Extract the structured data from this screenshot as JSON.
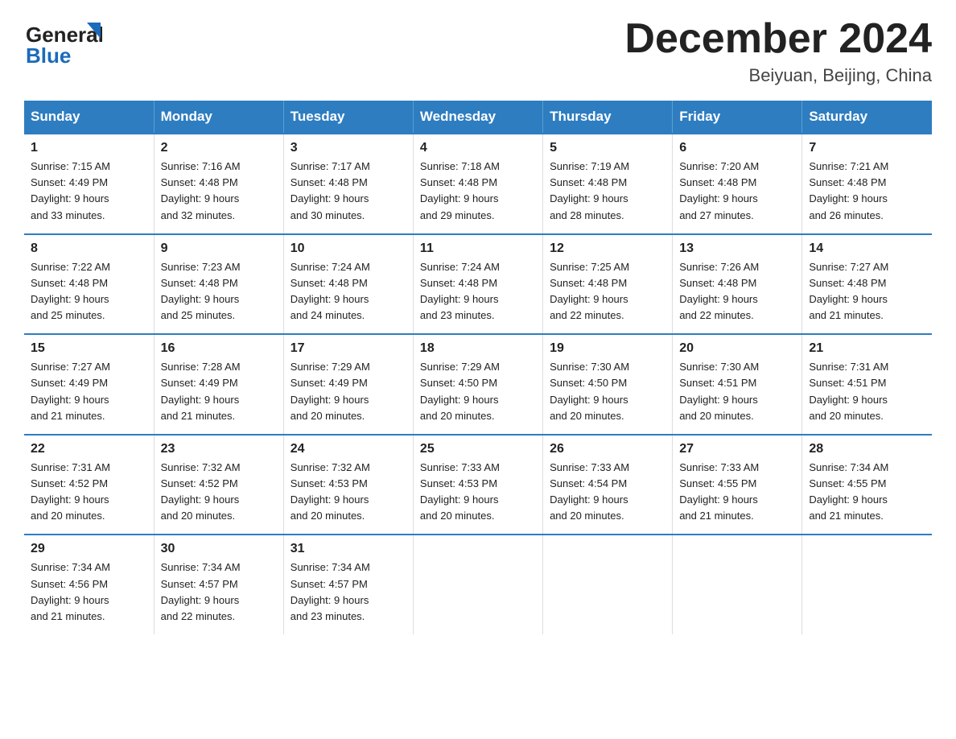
{
  "header": {
    "logo_general": "General",
    "logo_blue": "Blue",
    "month_title": "December 2024",
    "location": "Beiyuan, Beijing, China"
  },
  "days_of_week": [
    "Sunday",
    "Monday",
    "Tuesday",
    "Wednesday",
    "Thursday",
    "Friday",
    "Saturday"
  ],
  "weeks": [
    [
      {
        "day": "1",
        "sunrise": "7:15 AM",
        "sunset": "4:49 PM",
        "daylight": "9 hours and 33 minutes."
      },
      {
        "day": "2",
        "sunrise": "7:16 AM",
        "sunset": "4:48 PM",
        "daylight": "9 hours and 32 minutes."
      },
      {
        "day": "3",
        "sunrise": "7:17 AM",
        "sunset": "4:48 PM",
        "daylight": "9 hours and 30 minutes."
      },
      {
        "day": "4",
        "sunrise": "7:18 AM",
        "sunset": "4:48 PM",
        "daylight": "9 hours and 29 minutes."
      },
      {
        "day": "5",
        "sunrise": "7:19 AM",
        "sunset": "4:48 PM",
        "daylight": "9 hours and 28 minutes."
      },
      {
        "day": "6",
        "sunrise": "7:20 AM",
        "sunset": "4:48 PM",
        "daylight": "9 hours and 27 minutes."
      },
      {
        "day": "7",
        "sunrise": "7:21 AM",
        "sunset": "4:48 PM",
        "daylight": "9 hours and 26 minutes."
      }
    ],
    [
      {
        "day": "8",
        "sunrise": "7:22 AM",
        "sunset": "4:48 PM",
        "daylight": "9 hours and 25 minutes."
      },
      {
        "day": "9",
        "sunrise": "7:23 AM",
        "sunset": "4:48 PM",
        "daylight": "9 hours and 25 minutes."
      },
      {
        "day": "10",
        "sunrise": "7:24 AM",
        "sunset": "4:48 PM",
        "daylight": "9 hours and 24 minutes."
      },
      {
        "day": "11",
        "sunrise": "7:24 AM",
        "sunset": "4:48 PM",
        "daylight": "9 hours and 23 minutes."
      },
      {
        "day": "12",
        "sunrise": "7:25 AM",
        "sunset": "4:48 PM",
        "daylight": "9 hours and 22 minutes."
      },
      {
        "day": "13",
        "sunrise": "7:26 AM",
        "sunset": "4:48 PM",
        "daylight": "9 hours and 22 minutes."
      },
      {
        "day": "14",
        "sunrise": "7:27 AM",
        "sunset": "4:48 PM",
        "daylight": "9 hours and 21 minutes."
      }
    ],
    [
      {
        "day": "15",
        "sunrise": "7:27 AM",
        "sunset": "4:49 PM",
        "daylight": "9 hours and 21 minutes."
      },
      {
        "day": "16",
        "sunrise": "7:28 AM",
        "sunset": "4:49 PM",
        "daylight": "9 hours and 21 minutes."
      },
      {
        "day": "17",
        "sunrise": "7:29 AM",
        "sunset": "4:49 PM",
        "daylight": "9 hours and 20 minutes."
      },
      {
        "day": "18",
        "sunrise": "7:29 AM",
        "sunset": "4:50 PM",
        "daylight": "9 hours and 20 minutes."
      },
      {
        "day": "19",
        "sunrise": "7:30 AM",
        "sunset": "4:50 PM",
        "daylight": "9 hours and 20 minutes."
      },
      {
        "day": "20",
        "sunrise": "7:30 AM",
        "sunset": "4:51 PM",
        "daylight": "9 hours and 20 minutes."
      },
      {
        "day": "21",
        "sunrise": "7:31 AM",
        "sunset": "4:51 PM",
        "daylight": "9 hours and 20 minutes."
      }
    ],
    [
      {
        "day": "22",
        "sunrise": "7:31 AM",
        "sunset": "4:52 PM",
        "daylight": "9 hours and 20 minutes."
      },
      {
        "day": "23",
        "sunrise": "7:32 AM",
        "sunset": "4:52 PM",
        "daylight": "9 hours and 20 minutes."
      },
      {
        "day": "24",
        "sunrise": "7:32 AM",
        "sunset": "4:53 PM",
        "daylight": "9 hours and 20 minutes."
      },
      {
        "day": "25",
        "sunrise": "7:33 AM",
        "sunset": "4:53 PM",
        "daylight": "9 hours and 20 minutes."
      },
      {
        "day": "26",
        "sunrise": "7:33 AM",
        "sunset": "4:54 PM",
        "daylight": "9 hours and 20 minutes."
      },
      {
        "day": "27",
        "sunrise": "7:33 AM",
        "sunset": "4:55 PM",
        "daylight": "9 hours and 21 minutes."
      },
      {
        "day": "28",
        "sunrise": "7:34 AM",
        "sunset": "4:55 PM",
        "daylight": "9 hours and 21 minutes."
      }
    ],
    [
      {
        "day": "29",
        "sunrise": "7:34 AM",
        "sunset": "4:56 PM",
        "daylight": "9 hours and 21 minutes."
      },
      {
        "day": "30",
        "sunrise": "7:34 AM",
        "sunset": "4:57 PM",
        "daylight": "9 hours and 22 minutes."
      },
      {
        "day": "31",
        "sunrise": "7:34 AM",
        "sunset": "4:57 PM",
        "daylight": "9 hours and 23 minutes."
      },
      null,
      null,
      null,
      null
    ]
  ]
}
